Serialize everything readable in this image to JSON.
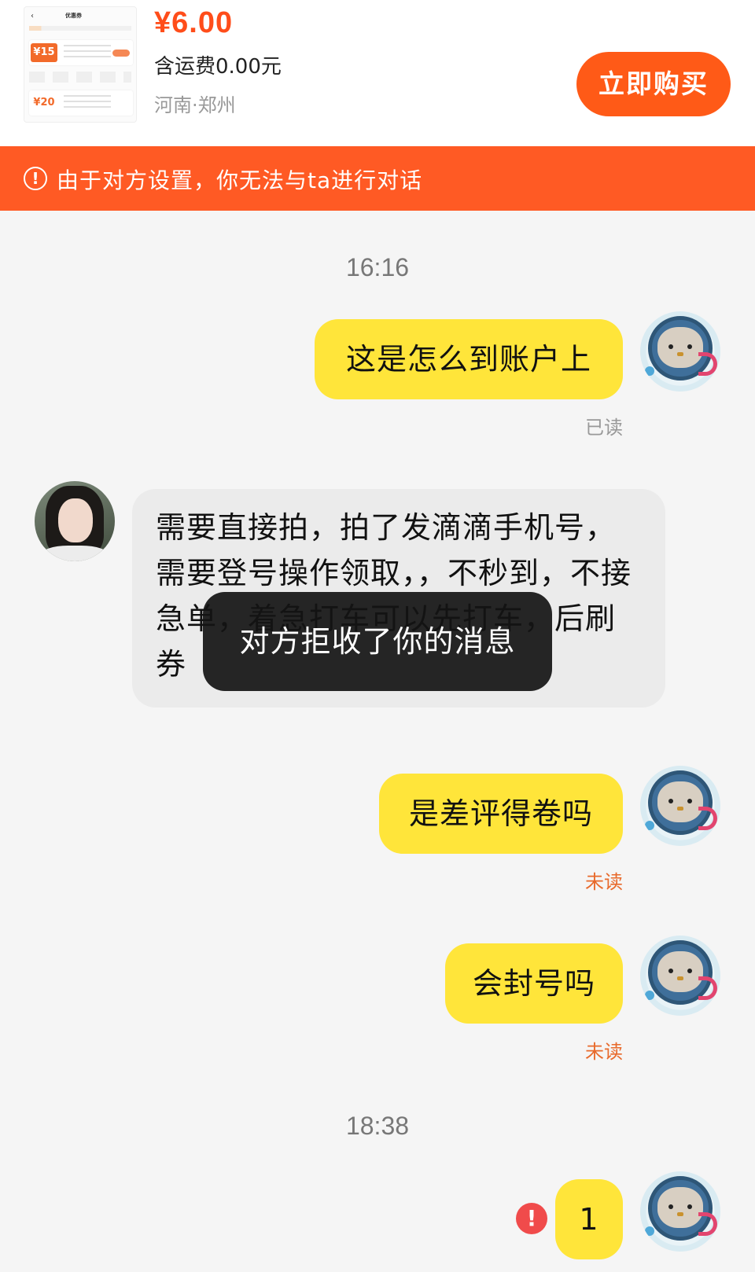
{
  "product": {
    "thumbnail": {
      "title": "优惠券",
      "badge_value_1": "¥15",
      "badge_value_2": "¥20"
    },
    "price": "¥6.00",
    "shipping": "含运费0.00元",
    "location": "河南·郑州",
    "buy_label": "立即购买"
  },
  "banner": {
    "icon": "alert-circle-icon",
    "text": "由于对方设置，你无法与ta进行对话",
    "color": "#ff5a24"
  },
  "chat": {
    "timestamps": [
      "16:16",
      "18:38"
    ],
    "messages": [
      {
        "from": "me",
        "text": "这是怎么到账户上",
        "status": "已读"
      },
      {
        "from": "other",
        "text": "需要直接拍，拍了发滴滴手机号，需要登号操作领取，，不秒到，不接急单，着急打车可以先打车，后刷券"
      },
      {
        "from": "me",
        "text": "是差评得卷吗",
        "status": "未读"
      },
      {
        "from": "me",
        "text": "会封号吗",
        "status": "未读"
      },
      {
        "from": "me",
        "text": "1",
        "status": "failed"
      }
    ],
    "toast": "对方拒收了你的消息"
  },
  "colors": {
    "accent": "#ff5a17",
    "my_bubble": "#ffe53a",
    "other_bubble": "#ebebeb",
    "unread": "#e86a2c",
    "error": "#f04b4b"
  }
}
